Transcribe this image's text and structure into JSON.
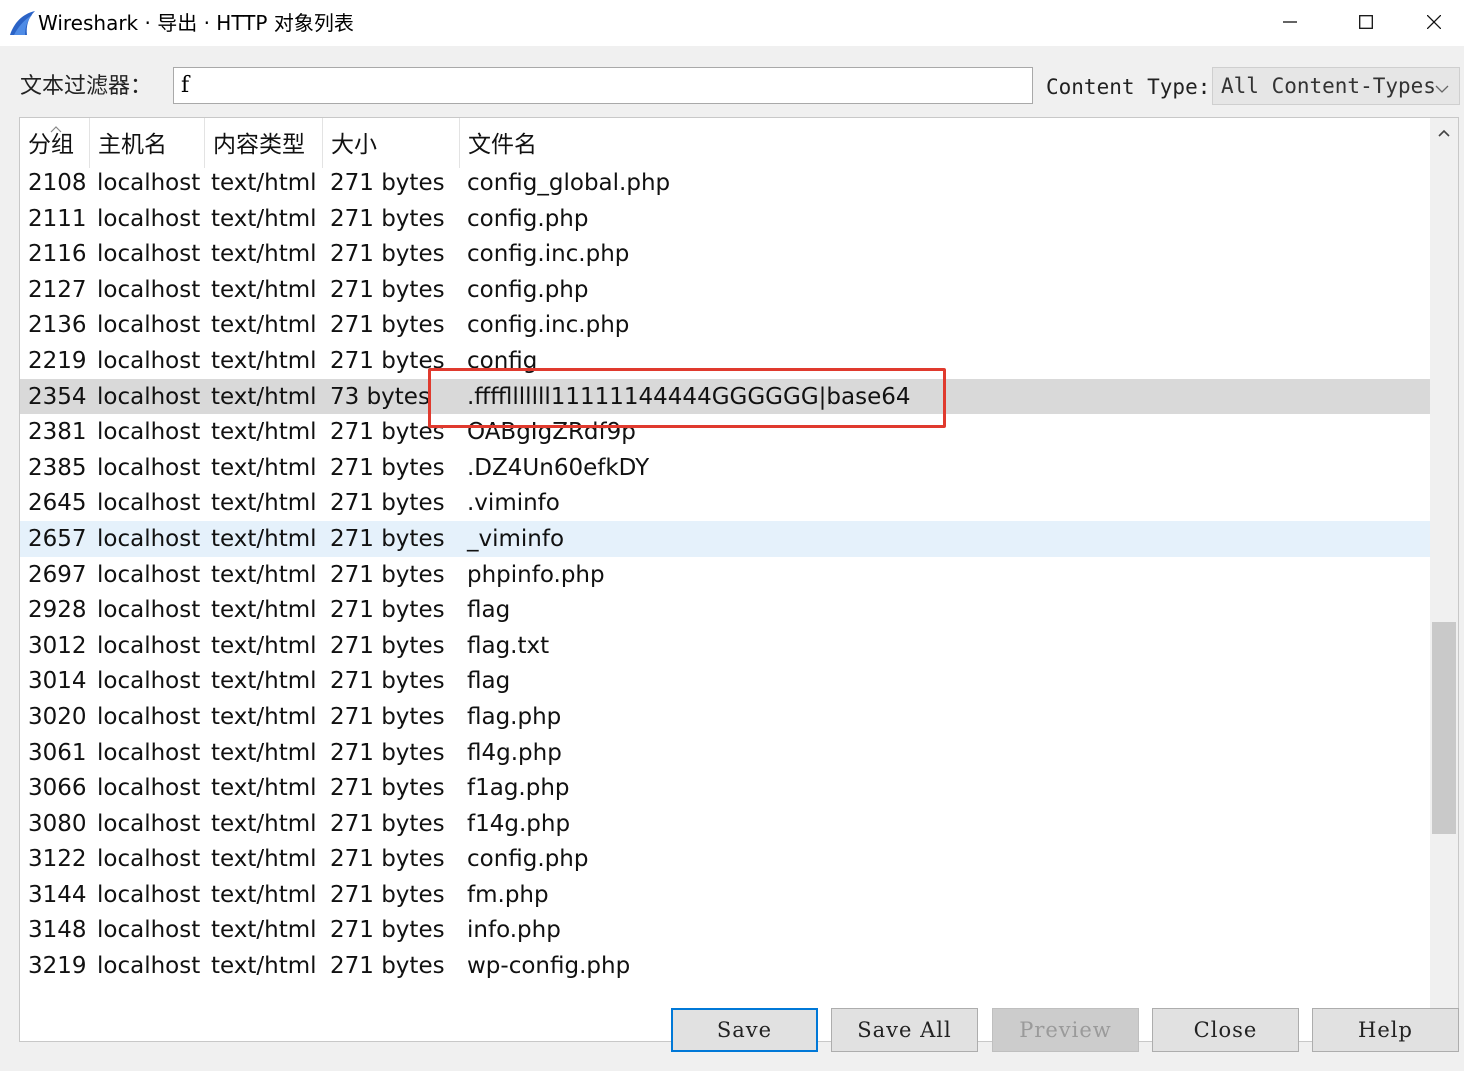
{
  "window": {
    "title": "Wireshark · 导出 · HTTP 对象列表",
    "icon": "wireshark-fin-icon",
    "controls": [
      "minimize-icon",
      "maximize-icon",
      "close-icon"
    ]
  },
  "filter": {
    "label": "文本过滤器：",
    "value": "f",
    "content_type_label": "Content Type:",
    "content_type_value": "All Content-Types"
  },
  "table": {
    "columns": [
      "分组",
      "主机名",
      "内容类型",
      "大小",
      "文件名"
    ],
    "rows": [
      {
        "packet": "2108",
        "host": "localhost",
        "type": "text/html",
        "size": "271 bytes",
        "file": "config_global.php"
      },
      {
        "packet": "2111",
        "host": "localhost",
        "type": "text/html",
        "size": "271 bytes",
        "file": "config.php"
      },
      {
        "packet": "2116",
        "host": "localhost",
        "type": "text/html",
        "size": "271 bytes",
        "file": "config.inc.php"
      },
      {
        "packet": "2127",
        "host": "localhost",
        "type": "text/html",
        "size": "271 bytes",
        "file": "config.php"
      },
      {
        "packet": "2136",
        "host": "localhost",
        "type": "text/html",
        "size": "271 bytes",
        "file": "config.inc.php"
      },
      {
        "packet": "2219",
        "host": "localhost",
        "type": "text/html",
        "size": "271 bytes",
        "file": "config"
      },
      {
        "packet": "2354",
        "host": "localhost",
        "type": "text/html",
        "size": "73 bytes",
        "file": ".fffflllllll11111144444GGGGGG|base64"
      },
      {
        "packet": "2381",
        "host": "localhost",
        "type": "text/html",
        "size": "271 bytes",
        "file": "OABgIgZRdf9p"
      },
      {
        "packet": "2385",
        "host": "localhost",
        "type": "text/html",
        "size": "271 bytes",
        "file": ".DZ4Un60efkDY"
      },
      {
        "packet": "2645",
        "host": "localhost",
        "type": "text/html",
        "size": "271 bytes",
        "file": ".viminfo"
      },
      {
        "packet": "2657",
        "host": "localhost",
        "type": "text/html",
        "size": "271 bytes",
        "file": "_viminfo"
      },
      {
        "packet": "2697",
        "host": "localhost",
        "type": "text/html",
        "size": "271 bytes",
        "file": "phpinfo.php"
      },
      {
        "packet": "2928",
        "host": "localhost",
        "type": "text/html",
        "size": "271 bytes",
        "file": "flag"
      },
      {
        "packet": "3012",
        "host": "localhost",
        "type": "text/html",
        "size": "271 bytes",
        "file": "flag.txt"
      },
      {
        "packet": "3014",
        "host": "localhost",
        "type": "text/html",
        "size": "271 bytes",
        "file": "flag"
      },
      {
        "packet": "3020",
        "host": "localhost",
        "type": "text/html",
        "size": "271 bytes",
        "file": "flag.php"
      },
      {
        "packet": "3061",
        "host": "localhost",
        "type": "text/html",
        "size": "271 bytes",
        "file": "fl4g.php"
      },
      {
        "packet": "3066",
        "host": "localhost",
        "type": "text/html",
        "size": "271 bytes",
        "file": "f1ag.php"
      },
      {
        "packet": "3080",
        "host": "localhost",
        "type": "text/html",
        "size": "271 bytes",
        "file": "f14g.php"
      },
      {
        "packet": "3122",
        "host": "localhost",
        "type": "text/html",
        "size": "271 bytes",
        "file": "config.php"
      },
      {
        "packet": "3144",
        "host": "localhost",
        "type": "text/html",
        "size": "271 bytes",
        "file": "fm.php"
      },
      {
        "packet": "3148",
        "host": "localhost",
        "type": "text/html",
        "size": "271 bytes",
        "file": "info.php"
      },
      {
        "packet": "3219",
        "host": "localhost",
        "type": "text/html",
        "size": "271 bytes",
        "file": "wp-config.php"
      }
    ],
    "selected_packet": "2354",
    "hovered_packet": "2657",
    "annotation_color": "#e03a2e"
  },
  "buttons": {
    "save": "Save",
    "save_all": "Save All",
    "preview": "Preview",
    "close": "Close",
    "help": "Help"
  }
}
